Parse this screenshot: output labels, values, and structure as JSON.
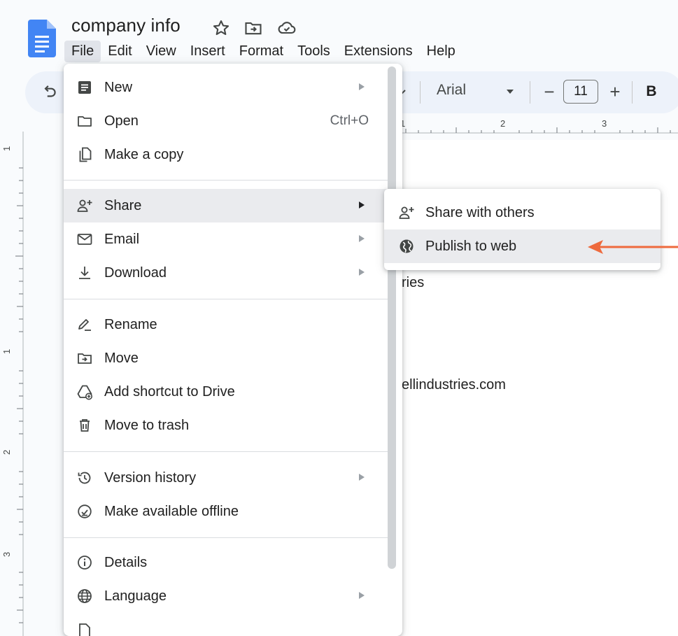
{
  "doc": {
    "title": "company info"
  },
  "menubar": [
    {
      "label": "File",
      "active": true
    },
    {
      "label": "Edit"
    },
    {
      "label": "View"
    },
    {
      "label": "Insert"
    },
    {
      "label": "Format"
    },
    {
      "label": "Tools"
    },
    {
      "label": "Extensions"
    },
    {
      "label": "Help"
    }
  ],
  "toolbar": {
    "font": "Arial",
    "font_size": "11",
    "minus": "−",
    "plus": "+",
    "bold": "B"
  },
  "ruler": {
    "h_ticks": [
      "1",
      "2",
      "3"
    ],
    "v_ticks": [
      "1",
      "1",
      "2",
      "3"
    ]
  },
  "page_text": {
    "line1": "ries",
    "line2": "ellindustries.com"
  },
  "file_menu": {
    "new": {
      "label": "New",
      "icon": "document-icon"
    },
    "open": {
      "label": "Open",
      "shortcut": "Ctrl+O",
      "icon": "folder-icon"
    },
    "copy": {
      "label": "Make a copy",
      "icon": "copy-icon"
    },
    "share": {
      "label": "Share",
      "icon": "person-add-icon"
    },
    "email": {
      "label": "Email",
      "icon": "mail-icon"
    },
    "download": {
      "label": "Download",
      "icon": "download-icon"
    },
    "rename": {
      "label": "Rename",
      "icon": "rename-icon"
    },
    "move": {
      "label": "Move",
      "icon": "move-folder-icon"
    },
    "shortcut": {
      "label": "Add shortcut to Drive",
      "icon": "drive-shortcut-icon"
    },
    "trash": {
      "label": "Move to trash",
      "icon": "trash-icon"
    },
    "version": {
      "label": "Version history",
      "icon": "history-icon"
    },
    "offline": {
      "label": "Make available offline",
      "icon": "offline-icon"
    },
    "details": {
      "label": "Details",
      "icon": "info-icon"
    },
    "language": {
      "label": "Language",
      "icon": "globe-icon"
    }
  },
  "share_submenu": {
    "share_with_others": {
      "label": "Share with others",
      "icon": "person-add-icon"
    },
    "publish": {
      "label": "Publish to web",
      "icon": "globe-filled-icon"
    }
  },
  "colors": {
    "docs_blue": "#4285f4",
    "annotation": "#ee6a3d",
    "highlight": "#eaebee"
  }
}
